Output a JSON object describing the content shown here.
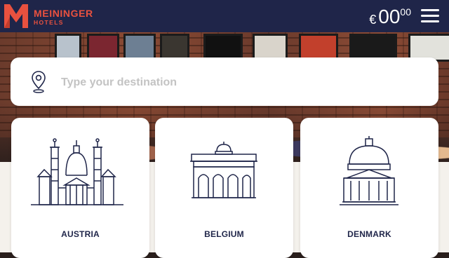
{
  "header": {
    "brand_name": "MEININGER",
    "brand_sub": "HOTELS",
    "currency": "€",
    "price_int": "00",
    "price_dec": "00",
    "menu_icon": "hamburger-menu-icon",
    "colors": {
      "bar": "#1f2549",
      "brand": "#e9513f"
    }
  },
  "search": {
    "placeholder": "Type your destination",
    "icon": "location-pin-icon"
  },
  "countries": [
    {
      "label": "AUSTRIA",
      "icon": "austria-landmark-icon"
    },
    {
      "label": "BELGIUM",
      "icon": "belgium-landmark-icon"
    },
    {
      "label": "DENMARK",
      "icon": "denmark-landmark-icon"
    }
  ]
}
